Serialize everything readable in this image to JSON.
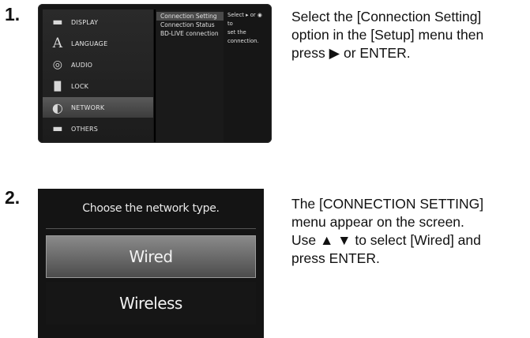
{
  "steps": [
    {
      "number": "1.",
      "text_lines": [
        "Select the [Connection Setting]",
        "option in the [Setup] menu then",
        "press ▶ or ENTER."
      ],
      "screen": {
        "menu_items": [
          {
            "label": "DISPLAY",
            "icon": "display-icon",
            "glyph": "▬"
          },
          {
            "label": "LANGUAGE",
            "icon": "language-icon",
            "glyph": "A"
          },
          {
            "label": "AUDIO",
            "icon": "audio-icon",
            "glyph": "◎"
          },
          {
            "label": "LOCK",
            "icon": "lock-icon",
            "glyph": "█"
          },
          {
            "label": "NETWORK",
            "icon": "network-icon",
            "glyph": "◐"
          },
          {
            "label": "OTHERS",
            "icon": "others-icon",
            "glyph": "▬"
          }
        ],
        "selected_menu": "NETWORK",
        "submenu_items": [
          "Connection Setting",
          "Connection Status",
          "BD-LIVE connection"
        ],
        "selected_submenu": "Connection Setting",
        "help_lines": [
          "Select ▸ or ◉ to",
          "set the connection."
        ]
      }
    },
    {
      "number": "2.",
      "text_lines": [
        "The [CONNECTION SETTING]",
        "menu appear on the screen.",
        "Use ▲ ▼ to select [Wired] and",
        "press ENTER."
      ],
      "screen": {
        "title": "Choose the network type.",
        "options": [
          "Wired",
          "Wireless"
        ],
        "selected_option": "Wired"
      }
    }
  ]
}
